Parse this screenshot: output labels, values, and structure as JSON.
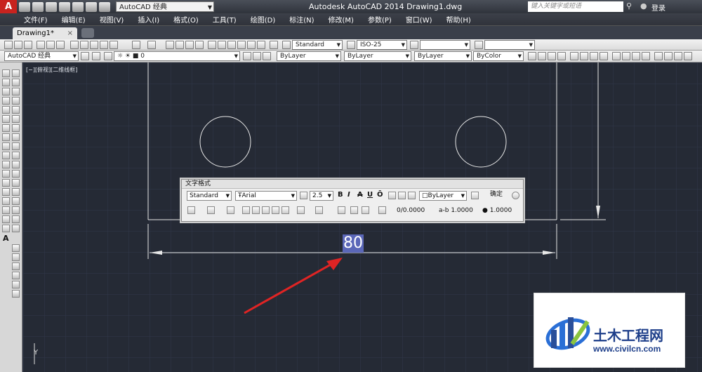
{
  "titlebar": {
    "app_logo": "A",
    "workspace": "AutoCAD 经典",
    "title": "Autodesk AutoCAD 2014    Drawing1.dwg",
    "search_placeholder": "键入关键字或短语",
    "login": "登录"
  },
  "menu": [
    "文件(F)",
    "编辑(E)",
    "视图(V)",
    "插入(I)",
    "格式(O)",
    "工具(T)",
    "绘图(D)",
    "标注(N)",
    "修改(M)",
    "参数(P)",
    "窗口(W)",
    "帮助(H)"
  ],
  "tabs": {
    "active": "Drawing1*",
    "close": "×"
  },
  "toolbar1": {
    "text_style": "Standard",
    "dim_style": "ISO-25"
  },
  "toolbar2": {
    "workspace": "AutoCAD 经典",
    "layer": "0",
    "color": "ByLayer",
    "linetype": "ByLayer",
    "lineweight": "ByLayer",
    "plotstyle": "ByColor"
  },
  "canvas": {
    "viewport_label": "[−][俯视][二维线框]",
    "dim_text": "80",
    "y_axis": "Y"
  },
  "text_format": {
    "title": "文字格式",
    "style": "Standard",
    "font": "Arial",
    "height": "2.5",
    "bold": "B",
    "italic": "I",
    "strike": "A",
    "underline": "U",
    "overline": "Ō",
    "color": "ByLayer",
    "ok": "确定",
    "oblique": "0.0000",
    "tracking": "1.0000",
    "width": "1.0000"
  },
  "watermark": {
    "title": "土木工程网",
    "url": "www.civilcn.com"
  },
  "colors": {
    "canvas_bg": "#252a35",
    "accent_red": "#e02424",
    "dim_highlight": "#5b67b8"
  }
}
